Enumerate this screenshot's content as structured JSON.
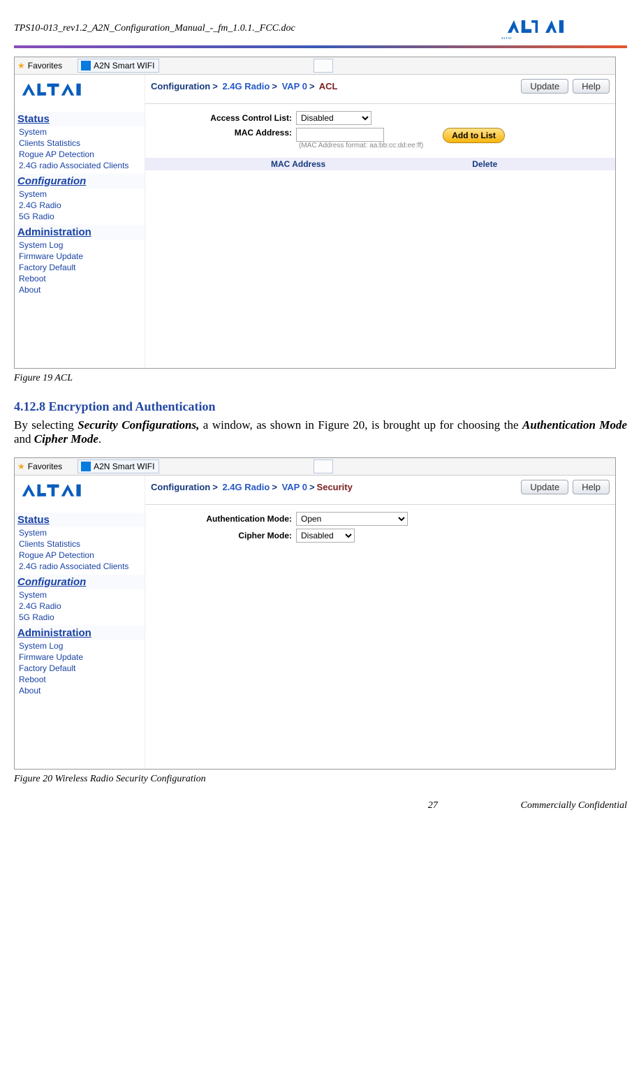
{
  "doc_header": "TPS10-013_rev1.2_A2N_Configuration_Manual_-_fm_1.0.1._FCC.doc",
  "brand": "ALTAI",
  "fig19": {
    "favorites_label": "Favorites",
    "tab_title": "A2N Smart WIFI",
    "crumbs": {
      "c1": "Configuration",
      "c2": "2.4G Radio",
      "c3": "VAP 0",
      "c4": "ACL"
    },
    "update_btn": "Update",
    "help_btn": "Help",
    "form": {
      "acl_label": "Access Control List:",
      "acl_value": "Disabled",
      "mac_label": "MAC Address:",
      "mac_value": "",
      "mac_hint": "(MAC Address format: aa:bb:cc:dd:ee:ff)",
      "add_btn": "Add to List",
      "col_mac": "MAC Address",
      "col_del": "Delete"
    },
    "sidebar": {
      "status_heading": "Status",
      "status_items": [
        "System",
        "Clients Statistics",
        "Rogue AP Detection",
        "2.4G radio Associated Clients"
      ],
      "config_heading": "Configuration",
      "config_items": [
        "System",
        "2.4G Radio",
        "5G Radio"
      ],
      "admin_heading": "Administration",
      "admin_items": [
        "System Log",
        "Firmware Update",
        "Factory Default",
        "Reboot",
        "About"
      ]
    },
    "caption": "Figure 19     ACL"
  },
  "section": {
    "heading": "4.12.8  Encryption and Authentication",
    "text_1": "By selecting ",
    "text_2": "Security Configurations,",
    "text_3": " a window, as shown in Figure 20, is brought up for choosing the ",
    "text_4": "Authentication Mode",
    "text_5": " and ",
    "text_6": "Cipher Mode",
    "text_7": "."
  },
  "fig20": {
    "favorites_label": "Favorites",
    "tab_title": "A2N Smart WIFI",
    "crumbs": {
      "c1": "Configuration",
      "c2": "2.4G Radio",
      "c3": "VAP 0",
      "c4": "Security"
    },
    "update_btn": "Update",
    "help_btn": "Help",
    "form": {
      "auth_label": "Authentication Mode:",
      "auth_value": "Open",
      "cipher_label": "Cipher Mode:",
      "cipher_value": "Disabled"
    },
    "sidebar": {
      "status_heading": "Status",
      "status_items": [
        "System",
        "Clients Statistics",
        "Rogue AP Detection",
        "2.4G radio Associated Clients"
      ],
      "config_heading": "Configuration",
      "config_items": [
        "System",
        "2.4G Radio",
        "5G Radio"
      ],
      "admin_heading": "Administration",
      "admin_items": [
        "System Log",
        "Firmware Update",
        "Factory Default",
        "Reboot",
        "About"
      ]
    },
    "caption": "Figure 20     Wireless Radio Security Configuration"
  },
  "footer": {
    "page": "27",
    "conf": "Commercially Confidential"
  }
}
